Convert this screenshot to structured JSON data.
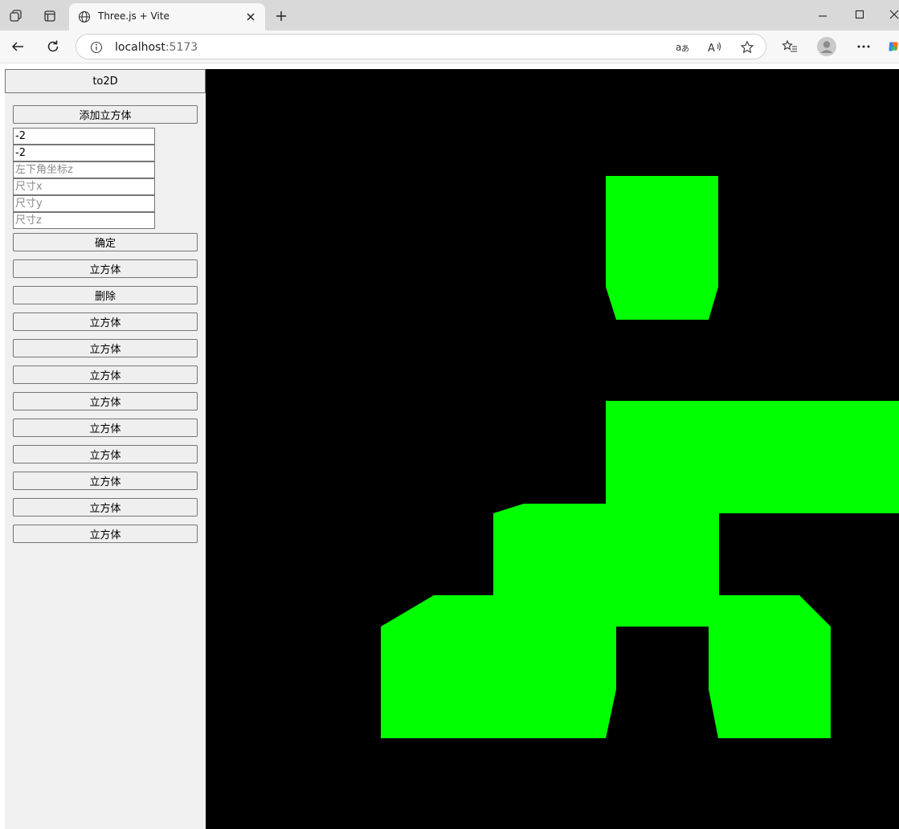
{
  "browser": {
    "tab_title": "Three.js + Vite",
    "url_host": "localhost",
    "url_port": ":5173",
    "icons": [
      "workspaces-icon",
      "tab-actions-icon",
      "globe-icon",
      "close-icon",
      "new-tab-icon",
      "minimize-icon",
      "maximize-icon",
      "back-icon",
      "refresh-icon",
      "info-icon",
      "translate-icon",
      "read-aloud-icon",
      "favorite-icon",
      "favorites-list-icon",
      "profile-icon",
      "more-icon",
      "copilot-icon"
    ]
  },
  "sidebar": {
    "to2d_label": "to2D",
    "add_cube_label": "添加立方体",
    "inputs": [
      {
        "value": "-2",
        "placeholder": ""
      },
      {
        "value": "-2",
        "placeholder": ""
      },
      {
        "value": "",
        "placeholder": "左下角坐标z"
      },
      {
        "value": "",
        "placeholder": "尺寸x"
      },
      {
        "value": "",
        "placeholder": "尺寸y"
      },
      {
        "value": "",
        "placeholder": "尺寸z"
      }
    ],
    "confirm_label": "确定",
    "cube_label_1": "立方体",
    "delete_label": "删除",
    "cube_items": [
      "立方体",
      "立方体",
      "立方体",
      "立方体",
      "立方体",
      "立方体",
      "立方体",
      "立方体",
      "立方体"
    ]
  },
  "scene": {
    "background": "#000000",
    "shape_color": "#00ff00"
  }
}
